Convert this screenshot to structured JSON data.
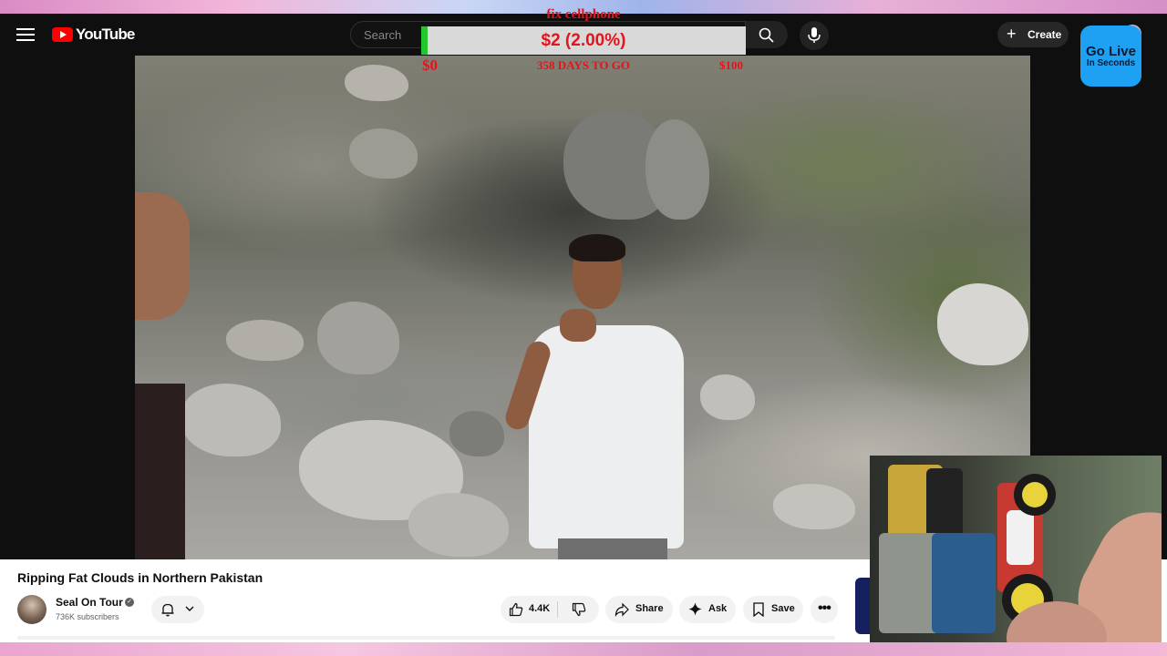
{
  "masthead": {
    "brand": "YouTube",
    "search_placeholder": "Search",
    "create_label": "Create"
  },
  "overlay": {
    "go_live_line1": "Go Live",
    "go_live_line2": "In Seconds",
    "goal_title": "fix cellphone",
    "goal_amount": "$2 (2.00%)",
    "goal_progress_percent": 2,
    "goal_start": "$0",
    "goal_days": "358 DAYS TO GO",
    "goal_end": "$100"
  },
  "video": {
    "title": "Ripping Fat Clouds in Northern Pakistan",
    "channel_name": "Seal On Tour",
    "subscribers": "736K subscribers",
    "likes": "4.4K",
    "share_label": "Share",
    "ask_label": "Ask",
    "save_label": "Save"
  },
  "colors": {
    "youtube_red": "#ff0000",
    "goal_text": "#e4141b",
    "goal_fill": "#22c72b",
    "go_live_bg": "#1ea1f2"
  },
  "icons": [
    "menu-icon",
    "youtube-logo-icon",
    "search-icon",
    "mic-icon",
    "plus-icon",
    "bell-icon",
    "chevron-down-icon",
    "thumbs-up-icon",
    "thumbs-down-icon",
    "share-icon",
    "sparkle-icon",
    "bookmark-icon",
    "more-icon",
    "verified-icon"
  ]
}
